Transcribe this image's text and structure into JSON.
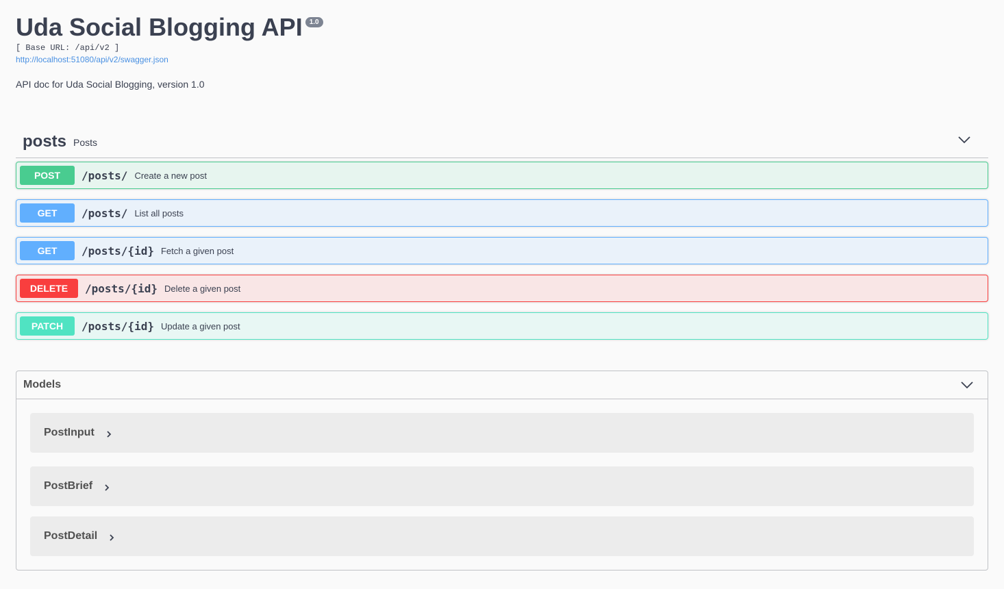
{
  "info": {
    "title": "Uda Social Blogging API",
    "version": "1.0",
    "base_url": "[ Base URL: /api/v2 ]",
    "spec_link": "http://localhost:51080/api/v2/swagger.json",
    "description": "API doc for Uda Social Blogging, version 1.0"
  },
  "tag": {
    "name": "posts",
    "description": "Posts",
    "icon": "chevron-down-icon"
  },
  "operations": [
    {
      "method": "POST",
      "path": "/posts/",
      "summary": "Create a new post",
      "color": "#49cc90"
    },
    {
      "method": "GET",
      "path": "/posts/",
      "summary": "List all posts",
      "color": "#61affe"
    },
    {
      "method": "GET",
      "path": "/posts/{id}",
      "summary": "Fetch a given post",
      "color": "#61affe"
    },
    {
      "method": "DELETE",
      "path": "/posts/{id}",
      "summary": "Delete a given post",
      "color": "#f93e3e"
    },
    {
      "method": "PATCH",
      "path": "/posts/{id}",
      "summary": "Update a given post",
      "color": "#50e3c2"
    }
  ],
  "models": {
    "title": "Models",
    "icon": "chevron-down-icon",
    "items": [
      {
        "name": "PostInput",
        "icon": "chevron-right-icon"
      },
      {
        "name": "PostBrief",
        "icon": "chevron-right-icon"
      },
      {
        "name": "PostDetail",
        "icon": "chevron-right-icon"
      }
    ]
  }
}
